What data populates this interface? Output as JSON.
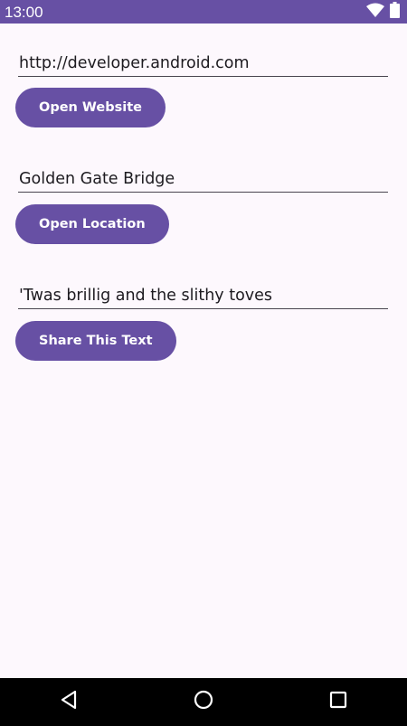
{
  "status_bar": {
    "time": "13:00",
    "icons": [
      "wifi-icon",
      "battery-icon"
    ]
  },
  "sections": [
    {
      "input_value": "http://developer.android.com",
      "button_label": "Open Website"
    },
    {
      "input_value": "Golden Gate Bridge",
      "button_label": "Open Location"
    },
    {
      "input_value": "'Twas brillig and the slithy toves",
      "button_label": "Share This Text"
    }
  ],
  "nav_bar": {
    "icons": [
      "back-icon",
      "home-icon",
      "recents-icon"
    ]
  },
  "colors": {
    "primary": "#6750a4",
    "background": "#fdf8fd",
    "nav_background": "#000000"
  }
}
